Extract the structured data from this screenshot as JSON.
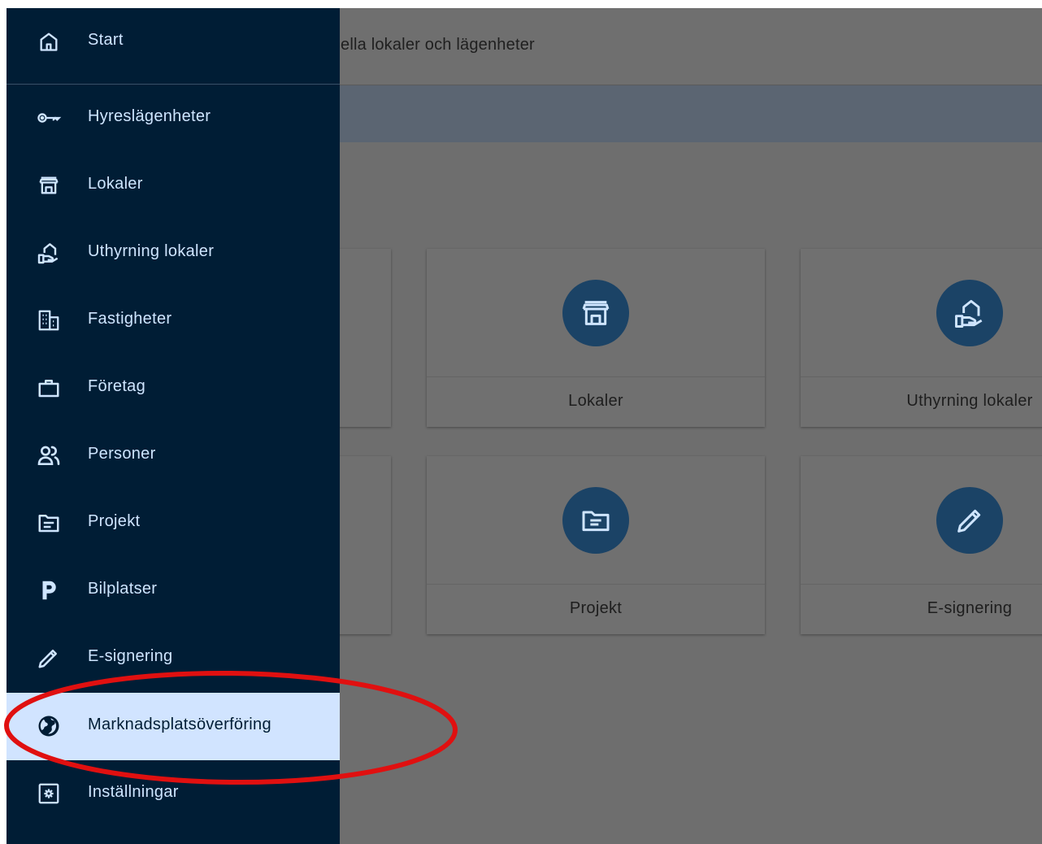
{
  "page": {
    "title_partial": "ella lokaler och lägenheter"
  },
  "cards": [
    {
      "label": "Lokaler",
      "icon": "storefront-icon"
    },
    {
      "label": "Uthyrning lokaler",
      "icon": "home-hand-icon"
    },
    {
      "label": "Projekt",
      "icon": "folder-document-icon"
    },
    {
      "label": "E-signering",
      "icon": "pencil-icon"
    }
  ],
  "sidebar": {
    "items": [
      {
        "label": "Start",
        "icon": "home-icon",
        "active": false
      },
      {
        "label": "Hyreslägenheter",
        "icon": "key-icon",
        "active": false
      },
      {
        "label": "Lokaler",
        "icon": "storefront-icon",
        "active": false
      },
      {
        "label": "Uthyrning lokaler",
        "icon": "home-hand-icon",
        "active": false
      },
      {
        "label": "Fastigheter",
        "icon": "building-icon",
        "active": false
      },
      {
        "label": "Företag",
        "icon": "briefcase-icon",
        "active": false
      },
      {
        "label": "Personer",
        "icon": "people-icon",
        "active": false
      },
      {
        "label": "Projekt",
        "icon": "folder-document-icon",
        "active": false
      },
      {
        "label": "Bilplatser",
        "icon": "parking-icon",
        "active": false
      },
      {
        "label": "E-signering",
        "icon": "pencil-icon",
        "active": false
      },
      {
        "label": "Marknadsplatsöverföring",
        "icon": "globe-icon",
        "active": true
      },
      {
        "label": "Inställningar",
        "icon": "settings-icon",
        "active": false
      }
    ]
  },
  "colors": {
    "sidebar_bg": "#001d35",
    "sidebar_text": "#cfe5ff",
    "active_bg": "#d1e4ff",
    "card_icon_bg": "#1b4366",
    "annotation": "#e01010"
  }
}
